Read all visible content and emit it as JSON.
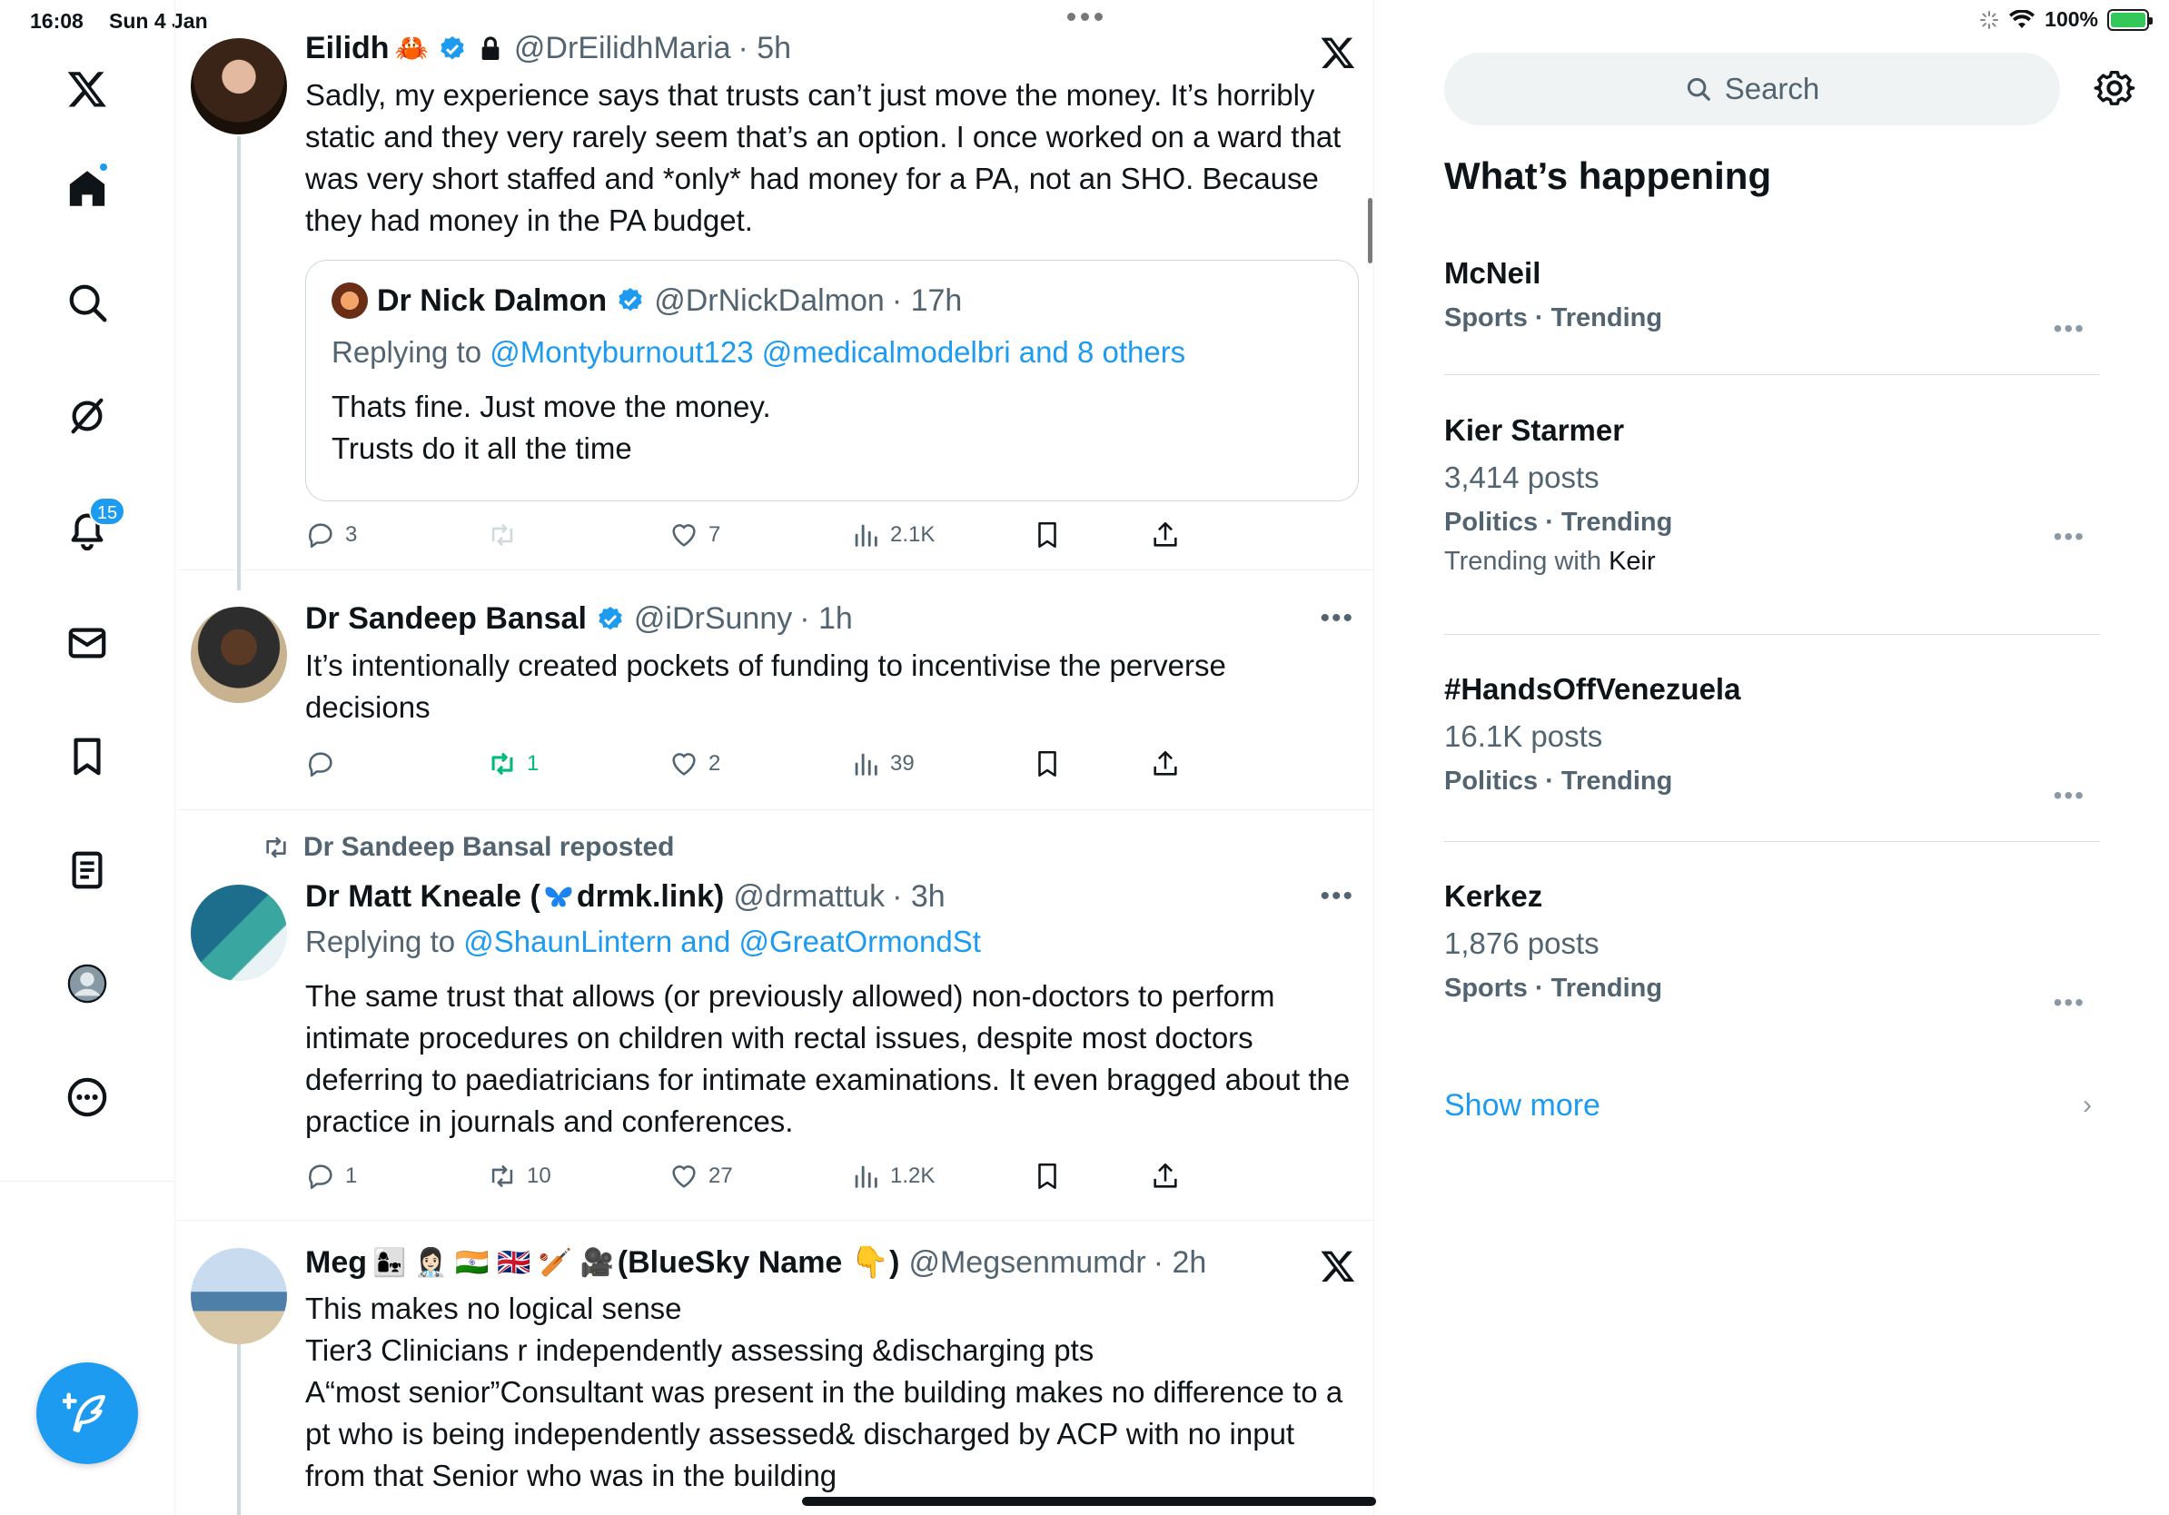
{
  "status_bar": {
    "time": "16:08",
    "date": "Sun 4 Jan",
    "battery": "100%"
  },
  "nav": {
    "notifications_count": "15",
    "items": [
      "x-logo-icon",
      "home-icon",
      "search-icon",
      "grok-icon",
      "bell-icon",
      "mail-icon",
      "bookmark-icon",
      "list-icon",
      "profile-icon",
      "more-icon"
    ]
  },
  "tweets": [
    {
      "name": "Eilidh",
      "emoji": "🦀",
      "handle": "@DrEilidhMaria",
      "time": "· 5h",
      "text": "Sadly, my experience says that trusts can’t just move the money. It’s horribly static and they very rarely seem that’s an option. I once worked on a ward that was very short staffed and *only* had money for a PA, not an SHO. Because they had money in the PA budget.",
      "quote": {
        "name": "Dr Nick Dalmon",
        "handle": "@DrNickDalmon",
        "time": "· 17h",
        "replying_prefix": "Replying to ",
        "replying_to": "@Montyburnout123 @medicalmodelbri and 8 others",
        "text": "Thats fine. Just move the money.\nTrusts do it all the time"
      },
      "replies": "3",
      "reposts": "",
      "likes": "7",
      "views": "2.1K"
    },
    {
      "name": "Dr Sandeep Bansal",
      "handle": "@iDrSunny",
      "time": "· 1h",
      "text": "It’s intentionally created pockets of funding to incentivise the perverse decisions",
      "replies": "",
      "reposts": "1",
      "likes": "2",
      "views": "39"
    },
    {
      "repost_label": "Dr Sandeep Bansal reposted",
      "name_prefix": "Dr Matt Kneale (",
      "name_suffix": "drmk.link)",
      "handle": "@drmattuk",
      "time": "· 3h",
      "replying_prefix": "Replying to ",
      "replying_to": "@ShaunLintern and @GreatOrmondSt",
      "text": "The same trust that allows (or previously allowed) non-doctors to perform intimate procedures on children with rectal issues, despite most doctors deferring to paediatricians for intimate examinations. It even bragged about the practice in journals and conferences.",
      "replies": "1",
      "reposts": "10",
      "likes": "27",
      "views": "1.2K"
    },
    {
      "name_prefix": "Meg",
      "emojis": "👩‍👧 👩🏻‍⚕️ 🇮🇳 🇬🇧 🏏 🎥",
      "name_suffix": "(BlueSky Name 👇)",
      "handle": "@Megsenmumdr",
      "time": "· 2h",
      "text": "This makes no logical sense\nTier3 Clinicians r independently assessing &discharging pts\nA“most senior”Consultant was present in the building makes no difference to a pt who is being independently assessed& discharged by ACP with no input from that Senior who was in the building"
    }
  ],
  "sidebar": {
    "search_placeholder": "Search",
    "title": "What’s happening",
    "trends": [
      {
        "name": "McNeil",
        "posts": "",
        "category": "Sports · Trending",
        "with_prefix": "",
        "with_term": ""
      },
      {
        "name": "Kier Starmer",
        "posts": "3,414 posts",
        "category": "Politics · Trending",
        "with_prefix": "Trending with ",
        "with_term": "Keir"
      },
      {
        "name": "#HandsOffVenezuela",
        "posts": "16.1K posts",
        "category": "Politics · Trending",
        "with_prefix": "",
        "with_term": ""
      },
      {
        "name": "Kerkez",
        "posts": "1,876 posts",
        "category": "Sports · Trending",
        "with_prefix": "",
        "with_term": ""
      }
    ],
    "show_more": "Show more"
  },
  "colors": {
    "accent": "#1d9bf0",
    "text_primary": "#0f1419",
    "text_secondary": "#536471",
    "repost_green": "#00ba7c"
  }
}
